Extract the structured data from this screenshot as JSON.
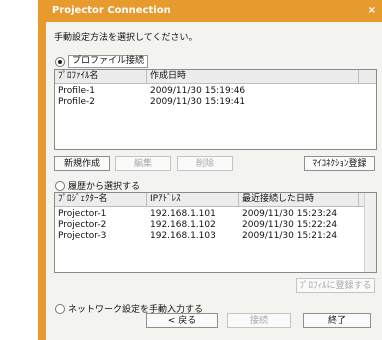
{
  "window": {
    "title": "Projector Connection",
    "close": "×"
  },
  "prompt": "手動設定方法を選択してください。",
  "profile": {
    "option_label": "プロファイル接続",
    "selected": true,
    "columns": [
      "ﾌﾟﾛﾌｧｲﾙ名",
      "作成日時"
    ],
    "rows": [
      [
        "Profile-1",
        "2009/11/30 15:19:46"
      ],
      [
        "Profile-2",
        "2009/11/30 15:19:41"
      ]
    ],
    "buttons": {
      "new": "新規作成",
      "edit": "編集",
      "delete": "削除",
      "register": "ﾏｲｺﾈｸｼｮﾝ登録"
    }
  },
  "history": {
    "option_label": "履歴から選択する",
    "selected": false,
    "columns": [
      "ﾌﾟﾛｼﾞｪｸﾀｰ名",
      "IPｱﾄﾞﾚｽ",
      "最近接続した日時"
    ],
    "rows": [
      [
        "Projector-1",
        "192.168.1.101",
        "2009/11/30 15:23:24"
      ],
      [
        "Projector-2",
        "192.168.1.102",
        "2009/11/30 15:22:24"
      ],
      [
        "Projector-3",
        "192.168.1.103",
        "2009/11/30 15:21:24"
      ]
    ],
    "register_button": "ﾌﾟﾛﾌｨﾙに登録する"
  },
  "manual": {
    "option_label": "ネットワーク設定を手動入力する",
    "selected": false
  },
  "footer": {
    "back": "< 戻る",
    "connect": "接続",
    "exit": "終了"
  },
  "colors": {
    "title_bar": "#e79b2f",
    "panel": "#f3f3ef"
  }
}
